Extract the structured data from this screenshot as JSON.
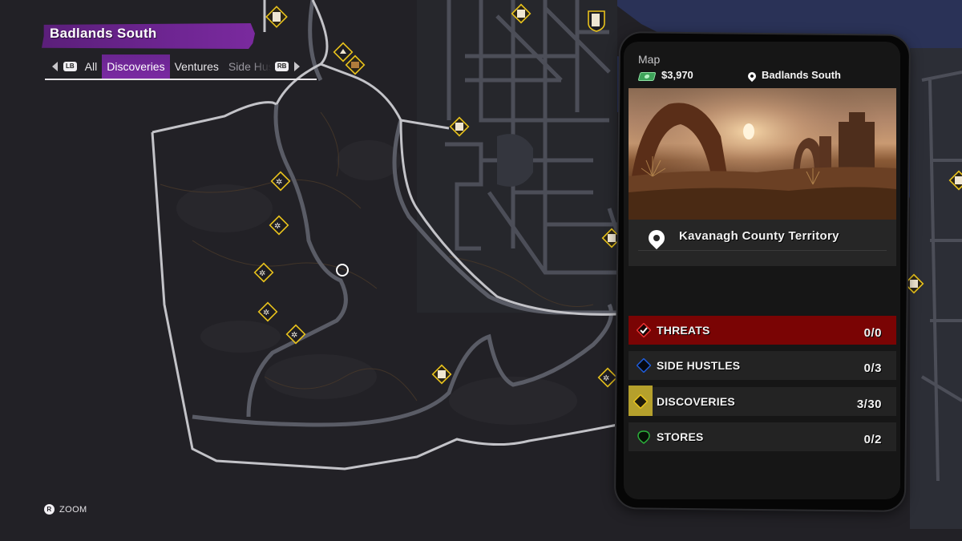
{
  "header": {
    "region_title": "Badlands South"
  },
  "filters": {
    "left_button": "LB",
    "right_button": "RB",
    "tabs": [
      {
        "label": "All",
        "active": false
      },
      {
        "label": "Discoveries",
        "active": true
      },
      {
        "label": "Ventures",
        "active": false
      },
      {
        "label": "Side Hustles",
        "active": false,
        "visible_text": "Side Hus"
      }
    ]
  },
  "footer": {
    "zoom_button": "R",
    "zoom_label": "ZOOM"
  },
  "map": {
    "player_marker": "player-location-icon",
    "icons": [
      {
        "type": "discovery-icon",
        "kind": "collectible"
      },
      {
        "type": "venture-icon",
        "kind": "collectible"
      },
      {
        "type": "store-icon",
        "kind": "shield"
      }
    ],
    "colors": {
      "background": "#222126",
      "road": "#5a5c66",
      "highway": "#c8c8cc",
      "water": "#2a3257",
      "marker_outline": "#e8c21c"
    }
  },
  "phone": {
    "app_title": "Map",
    "money_icon": "cash-icon",
    "money": "$3,970",
    "location_icon": "location-pin-icon",
    "current_region": "Badlands South",
    "image_alt": "desert-arches-sunset",
    "territory": "Kavanagh County Territory",
    "activities": [
      {
        "label": "THREATS",
        "count": "0/0",
        "icon": "threats-icon",
        "color": "#7a0404"
      },
      {
        "label": "SIDE HUSTLES",
        "count": "0/3",
        "icon": "side-hustles-icon",
        "color": "#1f5bd6"
      },
      {
        "label": "DISCOVERIES",
        "count": "3/30",
        "icon": "discoveries-icon",
        "color": "#b5a02c"
      },
      {
        "label": "STORES",
        "count": "0/2",
        "icon": "stores-icon",
        "color": "#2bb03a"
      }
    ]
  }
}
